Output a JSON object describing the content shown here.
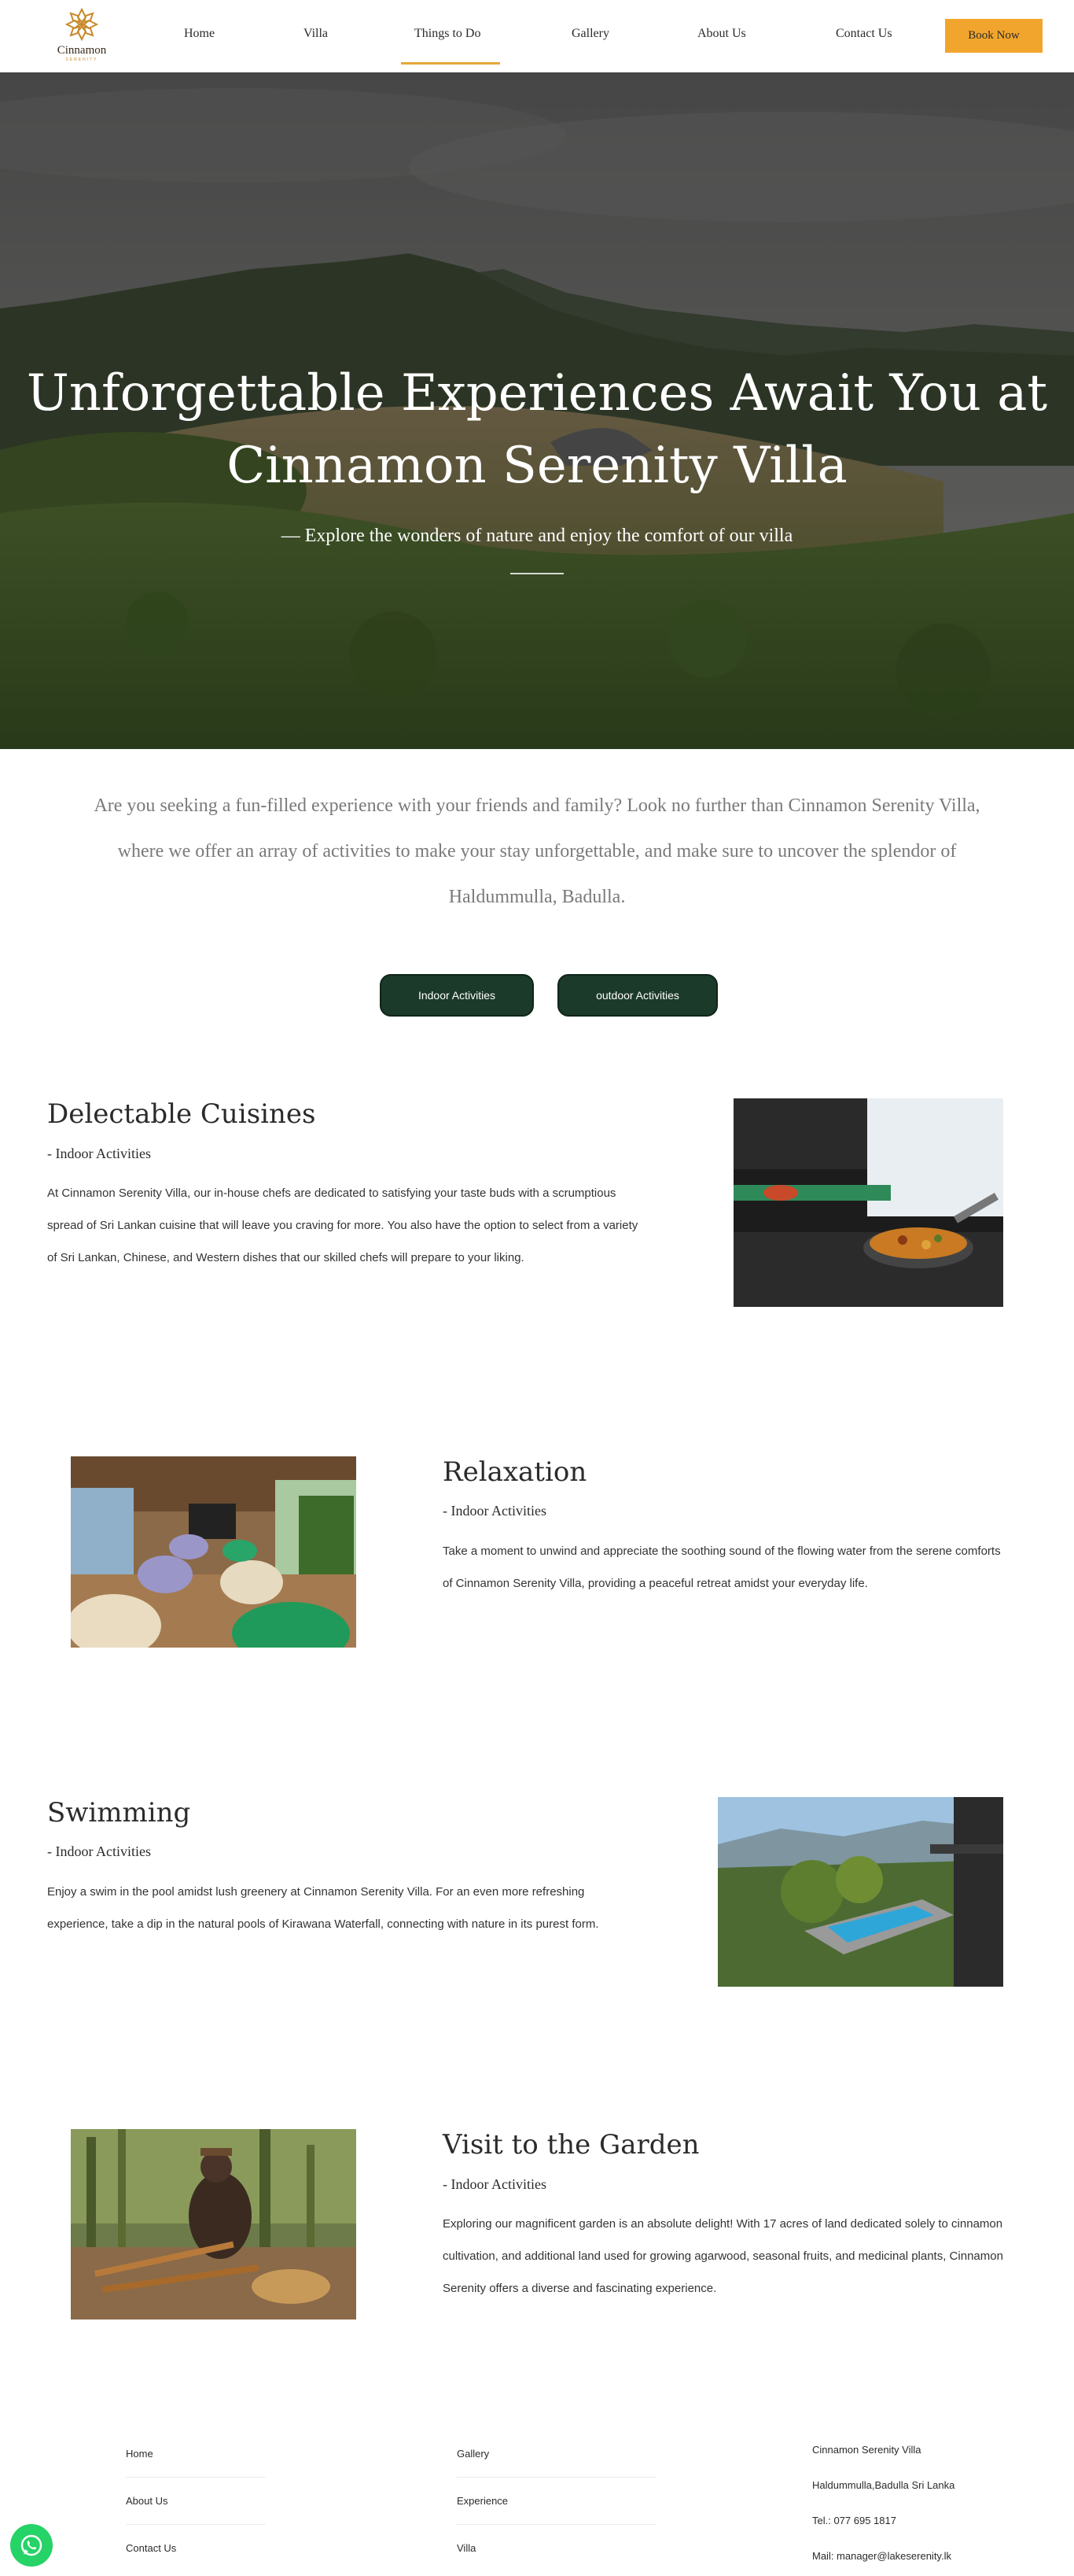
{
  "header": {
    "logo_text": "Cinnamon",
    "logo_sub": "SERENITY",
    "nav": [
      "Home",
      "Villa",
      "Things to Do",
      "Gallery",
      "About Us",
      "Contact Us"
    ],
    "active_nav": "Things to Do",
    "book_label": "Book Now",
    "accent_color": "#f2a52c"
  },
  "hero": {
    "title_line1": "Unforgettable Experiences Await You at",
    "title_line2": "Cinnamon Serenity Villa",
    "subtitle": "— Explore the wonders of nature and enjoy the comfort of our villa"
  },
  "intro": {
    "text": "Are you seeking a fun-filled experience with your friends and family? Look no further than Cinnamon Serenity Villa, where we offer an array of activities to make your stay unforgettable, and make sure to uncover the splendor of Haldummulla, Badulla."
  },
  "filters": {
    "indoor_label": "Indoor Activities",
    "outdoor_label": "outdoor Activities",
    "button_color": "#1c3a2a"
  },
  "sections": [
    {
      "title": "Delectable Cuisines",
      "subtitle": "- Indoor Activities",
      "body": "At Cinnamon Serenity Villa, our in-house chefs are dedicated to satisfying your taste buds with a scrumptious spread of Sri Lankan cuisine that will leave you craving for more. You also have the option to select from a variety of Sri Lankan, Chinese, and Western dishes that our skilled chefs will prepare to your liking.",
      "image": "chef-cooking-image"
    },
    {
      "title": "Relaxation",
      "subtitle": "- Indoor Activities",
      "body": "Take a moment to unwind and appreciate the soothing sound of the flowing water from the serene comforts of Cinnamon Serenity Villa, providing a peaceful retreat amidst your everyday life.",
      "image": "lounge-beanbags-image"
    },
    {
      "title": "Swimming",
      "subtitle": "- Indoor Activities",
      "body": "Enjoy a swim in the pool amidst lush greenery at Cinnamon Serenity Villa. For an even more refreshing experience, take a dip in the natural pools of Kirawana Waterfall, connecting with nature in its purest form.",
      "image": "pool-view-image"
    },
    {
      "title": "Visit to the Garden",
      "subtitle": "- Indoor Activities",
      "body": "Exploring our magnificent garden is an absolute delight! With 17 acres of land dedicated solely to cinnamon cultivation, and additional land used for growing agarwood, seasonal fruits, and medicinal plants, Cinnamon Serenity offers a diverse and fascinating experience.",
      "image": "cinnamon-peeling-image"
    }
  ],
  "footer": {
    "col1": [
      "Home",
      "About Us",
      "Contact Us"
    ],
    "col2": [
      "Gallery",
      "Experience",
      "Villa"
    ],
    "info": [
      "Cinnamon Serenity Villa",
      "Haldummulla,Badulla Sri Lanka",
      "Tel.: 077 695 1817",
      "Mail: manager@lakeserenity.lk"
    ]
  }
}
